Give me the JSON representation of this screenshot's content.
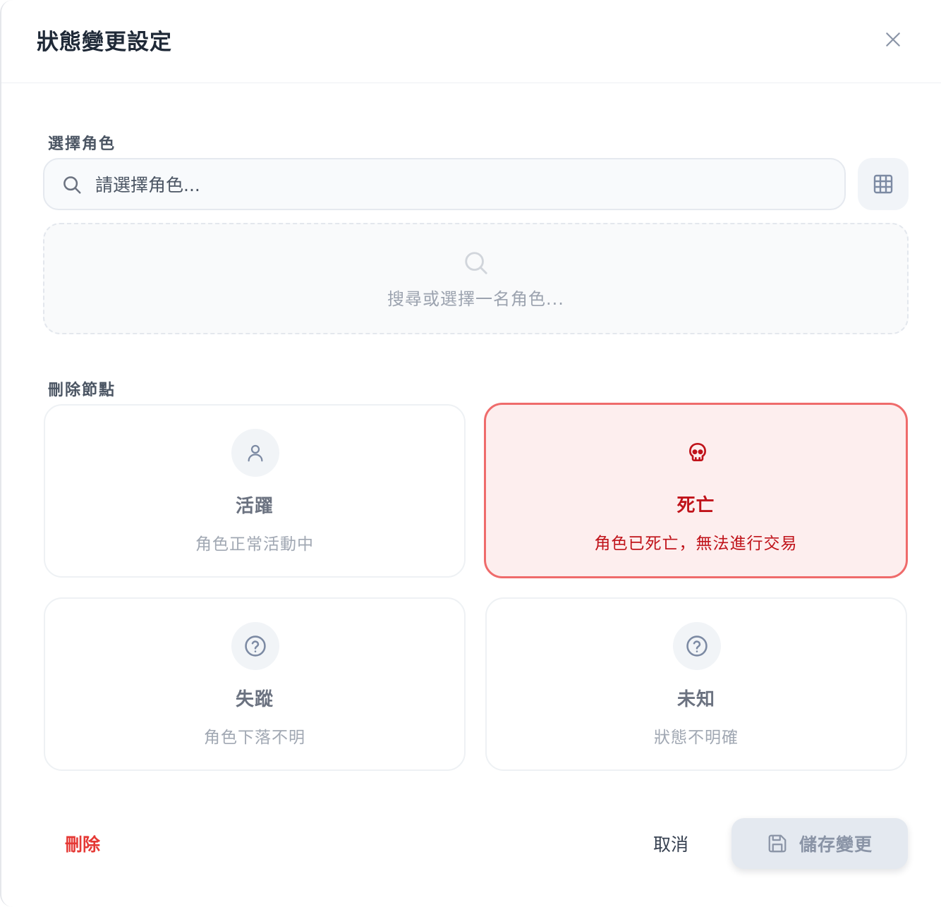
{
  "dialog": {
    "title": "狀態變更設定"
  },
  "character_select": {
    "label": "選擇角色",
    "placeholder": "請選擇角色...",
    "empty_hint": "搜尋或選擇一名角色..."
  },
  "status_section": {
    "label": "刪除節點",
    "selected": "dead",
    "options": [
      {
        "key": "active",
        "name": "活躍",
        "desc": "角色正常活動中",
        "icon": "user-icon"
      },
      {
        "key": "dead",
        "name": "死亡",
        "desc": "角色已死亡，無法進行交易",
        "icon": "skull-icon"
      },
      {
        "key": "missing",
        "name": "失蹤",
        "desc": "角色下落不明",
        "icon": "question-circle-icon"
      },
      {
        "key": "unknown",
        "name": "未知",
        "desc": "狀態不明確",
        "icon": "question-circle-icon"
      }
    ]
  },
  "footer": {
    "delete_label": "刪除",
    "cancel_label": "取消",
    "save_label": "儲存變更"
  },
  "colors": {
    "accent_red": "#c0131a",
    "selected_border": "#ef6b6b",
    "selected_bg": "#fdeeee",
    "delete_red": "#e53935"
  }
}
